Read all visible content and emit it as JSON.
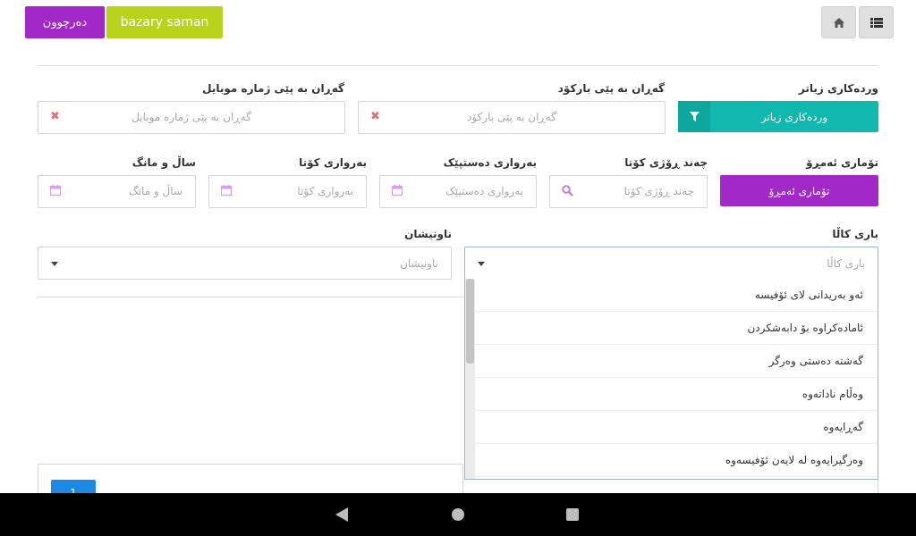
{
  "header": {
    "logout_label": "دەرچوون",
    "brand_label": "bazary saman",
    "home_icon": "home-icon",
    "menu_icon": "list-icon"
  },
  "filters": {
    "more_filters_label": "وردەکاری زیاتر",
    "more_filters_button": "وردەکاری زیاتر",
    "barcode_label": "گەڕان بە پێی بارکۆد",
    "barcode_placeholder": "گەڕان بە پێی بارکۆد",
    "mobile_label": "گەڕان بە پێی ژمارە موبایل",
    "mobile_placeholder": "گەڕان بە پێی ژمارە موبایل",
    "archive_label": "تۆماری ئەمڕۆ",
    "archive_button": "تۆماری ئەمڕۆ",
    "last_days_label": "چەند ڕۆژی کۆتا",
    "last_days_placeholder": "چەند ڕۆژی کۆتا",
    "start_date_label": "بەرواری دەستپێک",
    "start_date_placeholder": "بەرواری دەستپێک",
    "end_date_label": "بەرواری کۆتا",
    "end_date_placeholder": "بەرواری کۆتا",
    "year_month_label": "ساڵ و مانگ",
    "year_month_placeholder": "ساڵ و مانگ",
    "status_label": "باری کاڵا",
    "status_placeholder": "باری کاڵا",
    "address_label": "ناونیشان",
    "address_placeholder": "ناونیشان"
  },
  "status_dropdown": {
    "options": [
      "ئەو بەریدانی لای ئۆفیسە",
      "ئامادەکراوە بۆ دابەشکردن",
      "گەشتە دەستی وەرگر",
      "وەڵام ناداتەوە",
      "گەڕایەوە",
      "وەرگیرایەوە لە لایەن ئۆفیسەوە"
    ]
  },
  "pagination": {
    "current_page": "1"
  },
  "colors": {
    "purple": "#a229c8",
    "lime": "#b8d41a",
    "teal": "#11b8ad",
    "blue": "#1e88e5"
  }
}
